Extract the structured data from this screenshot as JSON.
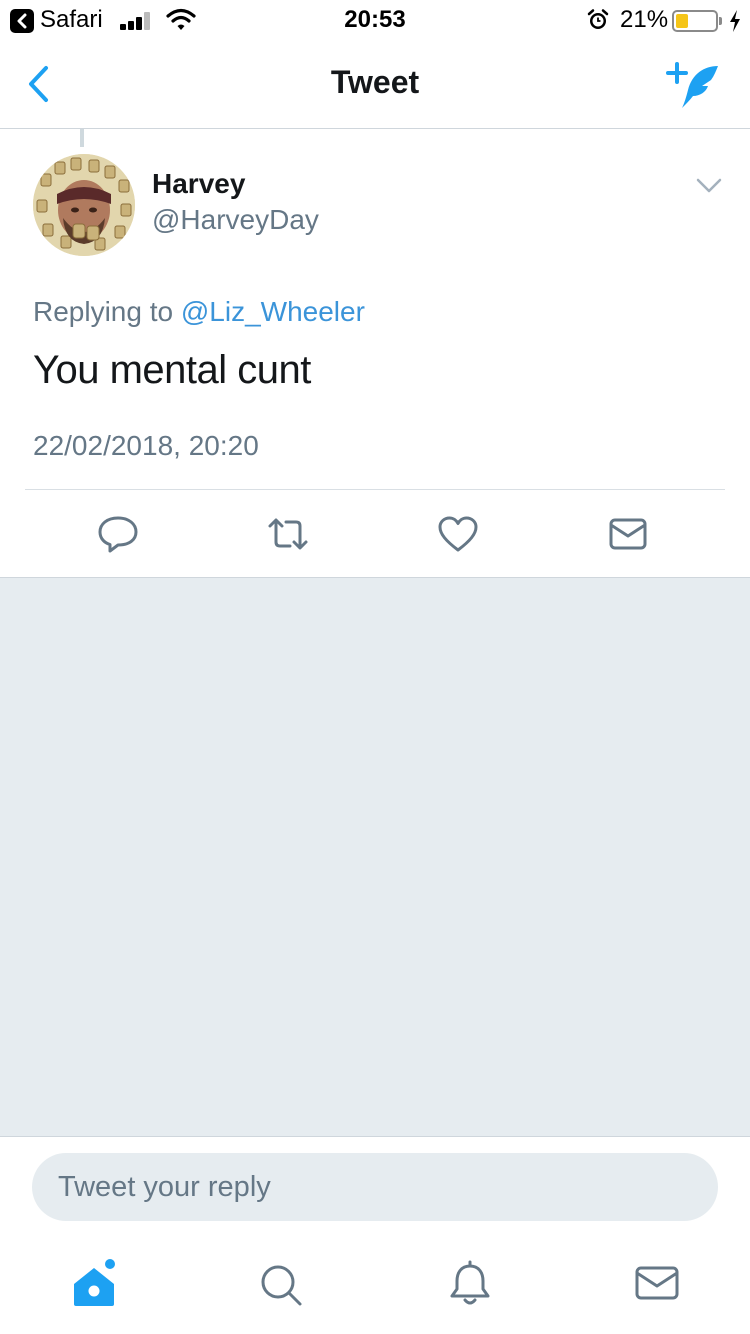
{
  "status_bar": {
    "app_name": "Safari",
    "time": "20:53",
    "battery_percent_label": "21%",
    "battery_level": 0.21
  },
  "nav": {
    "title": "Tweet",
    "back_icon": "chevron-left-icon",
    "compose_icon": "compose-tweet-icon"
  },
  "tweet": {
    "display_name": "Harvey",
    "handle": "@HarveyDay",
    "replying_prefix": "Replying to",
    "replying_to": "@Liz_Wheeler",
    "text": "You mental cunt",
    "timestamp": "22/02/2018, 20:20"
  },
  "actions": [
    {
      "name": "reply",
      "icon": "reply-icon"
    },
    {
      "name": "retweet",
      "icon": "retweet-icon"
    },
    {
      "name": "like",
      "icon": "heart-icon"
    },
    {
      "name": "direct-message",
      "icon": "envelope-icon"
    }
  ],
  "reply_bar": {
    "placeholder": "Tweet your reply"
  },
  "tab_bar": [
    {
      "name": "home",
      "icon": "home-icon",
      "active": true,
      "has_notification_dot": true
    },
    {
      "name": "search",
      "icon": "search-icon",
      "active": false
    },
    {
      "name": "notifications",
      "icon": "bell-icon",
      "active": false
    },
    {
      "name": "messages",
      "icon": "envelope-icon",
      "active": false
    }
  ],
  "colors": {
    "accent": "#1da1f2",
    "link": "#3b94d9",
    "secondary_text": "#657786",
    "icon_gray": "#657786",
    "background_gray": "#e6ecf0",
    "battery_fill": "#f5c518"
  }
}
